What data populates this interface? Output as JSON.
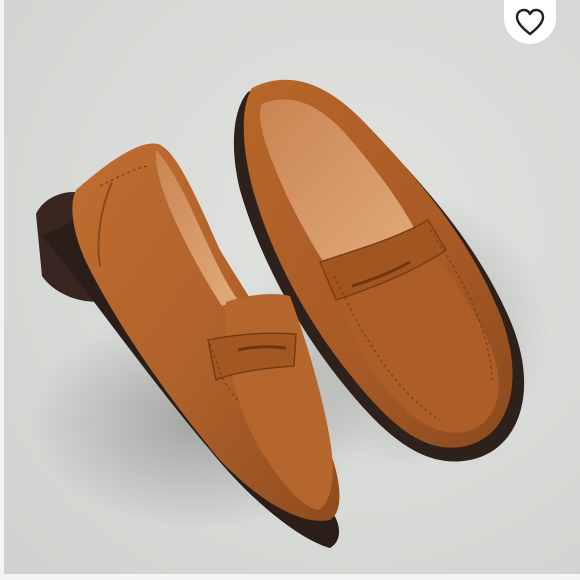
{
  "listing": {
    "photo_subject": "shoe-photo",
    "colors": {
      "background": "#d8dad7",
      "leather": "#b0622b",
      "leather_dark": "#8a4a1f",
      "sole": "#3a2a22",
      "lining": "#d89a69"
    }
  },
  "actions": {
    "like_icon": "heart-outline-icon"
  }
}
